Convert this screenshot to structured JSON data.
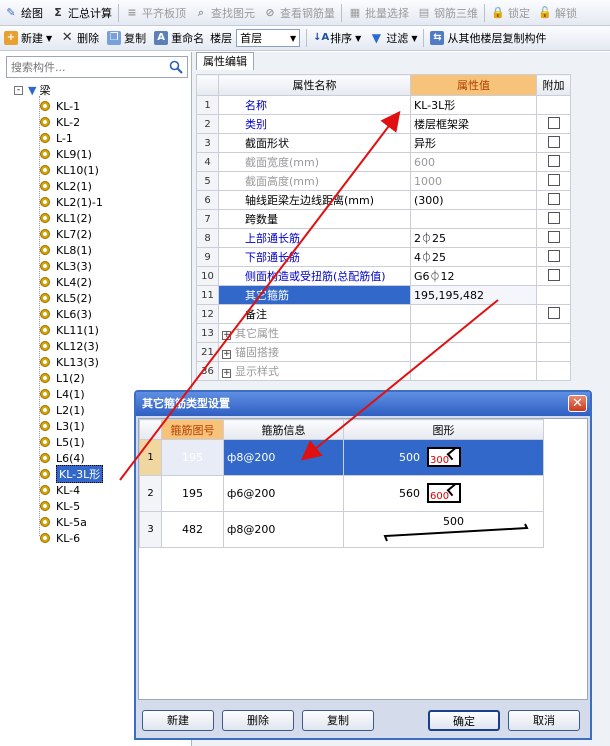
{
  "toolbar1": {
    "items": [
      {
        "label": "绘图",
        "icon": "draw-icon",
        "enabled": true
      },
      {
        "label": "汇总计算",
        "icon": "sigma-icon",
        "enabled": true
      },
      {
        "label": "平齐板顶",
        "icon": "align-slab-icon",
        "enabled": false
      },
      {
        "label": "查找图元",
        "icon": "find-element-icon",
        "enabled": false
      },
      {
        "label": "查看钢筋量",
        "icon": "view-rebar-icon",
        "enabled": false
      },
      {
        "label": "批量选择",
        "icon": "batch-select-icon",
        "enabled": false
      },
      {
        "label": "钢筋三维",
        "icon": "rebar-3d-icon",
        "enabled": false
      },
      {
        "label": "锁定",
        "icon": "lock-icon",
        "enabled": false
      },
      {
        "label": "解锁",
        "icon": "unlock-icon",
        "enabled": false
      }
    ]
  },
  "toolbar2": {
    "new_label": "新建",
    "delete_label": "删除",
    "copy_label": "复制",
    "rename_label": "重命名",
    "floor_label": "楼层",
    "floor_value": "首层",
    "sort_label": "排序",
    "filter_label": "过滤",
    "copy_from_floor_label": "从其他楼层复制构件"
  },
  "search": {
    "placeholder": "搜索构件..."
  },
  "tree": {
    "root": "梁",
    "items": [
      "KL-1",
      "KL-2",
      "L-1",
      "KL9(1)",
      "KL10(1)",
      "KL2(1)",
      "KL2(1)-1",
      "KL1(2)",
      "KL7(2)",
      "KL8(1)",
      "KL3(3)",
      "KL4(2)",
      "KL5(2)",
      "KL6(3)",
      "KL11(1)",
      "KL12(3)",
      "KL13(3)",
      "L1(2)",
      "L4(1)",
      "L2(1)",
      "L3(1)",
      "L5(1)",
      "L6(4)",
      "KL-3L形",
      "KL-4",
      "KL-5",
      "KL-5a",
      "KL-6"
    ],
    "selected_index": 23
  },
  "property_tab": "属性编辑",
  "property_table": {
    "headers": [
      "属性名称",
      "属性值",
      "附加"
    ],
    "rows": [
      {
        "num": "1",
        "name": "名称",
        "value": "KL-3L形",
        "style": "blue",
        "check": false
      },
      {
        "num": "2",
        "name": "类别",
        "value": "楼层框架梁",
        "style": "blue",
        "check": true
      },
      {
        "num": "3",
        "name": "截面形状",
        "value": "异形",
        "style": "",
        "check": true
      },
      {
        "num": "4",
        "name": "截面宽度(mm)",
        "value": "600",
        "style": "gray",
        "check": true
      },
      {
        "num": "5",
        "name": "截面高度(mm)",
        "value": "1000",
        "style": "gray",
        "check": true
      },
      {
        "num": "6",
        "name": "轴线距梁左边线距离(mm)",
        "value": "(300)",
        "style": "",
        "check": true
      },
      {
        "num": "7",
        "name": "跨数量",
        "value": "",
        "style": "",
        "check": true
      },
      {
        "num": "8",
        "name": "上部通长筋",
        "value": "2⏀25",
        "style": "blue",
        "check": true
      },
      {
        "num": "9",
        "name": "下部通长筋",
        "value": "4⏀25",
        "style": "blue",
        "check": true
      },
      {
        "num": "10",
        "name": "侧面构造或受扭筋(总配筋值)",
        "value": "G6⏀12",
        "style": "blue",
        "check": true
      },
      {
        "num": "11",
        "name": "其它箍筋",
        "value": "195,195,482",
        "style": "sel",
        "check": false
      },
      {
        "num": "12",
        "name": "备注",
        "value": "",
        "style": "",
        "check": true
      },
      {
        "num": "13",
        "name": "其它属性",
        "value": "",
        "style": "group",
        "check": false
      },
      {
        "num": "21",
        "name": "锚固搭接",
        "value": "",
        "style": "group",
        "check": false
      },
      {
        "num": "36",
        "name": "显示样式",
        "value": "",
        "style": "group",
        "check": false
      }
    ]
  },
  "dialog": {
    "title": "其它箍筋类型设置",
    "headers": [
      "箍筋图号",
      "箍筋信息",
      "图形"
    ],
    "rows": [
      {
        "num": "1",
        "code": "195",
        "info": "ф8@200",
        "len": "500",
        "hook": "300"
      },
      {
        "num": "2",
        "code": "195",
        "info": "ф6@200",
        "len": "560",
        "hook": "600"
      },
      {
        "num": "3",
        "code": "482",
        "info": "ф8@200",
        "len": "500",
        "hook": ""
      }
    ],
    "buttons": {
      "new": "新建",
      "delete": "删除",
      "copy": "复制",
      "ok": "确定",
      "cancel": "取消"
    }
  },
  "colors": {
    "accent": "#3168c9",
    "highlight_header": "#f7c27a",
    "arrow": "#e01010",
    "dialog_title": "#2f5fc2"
  }
}
